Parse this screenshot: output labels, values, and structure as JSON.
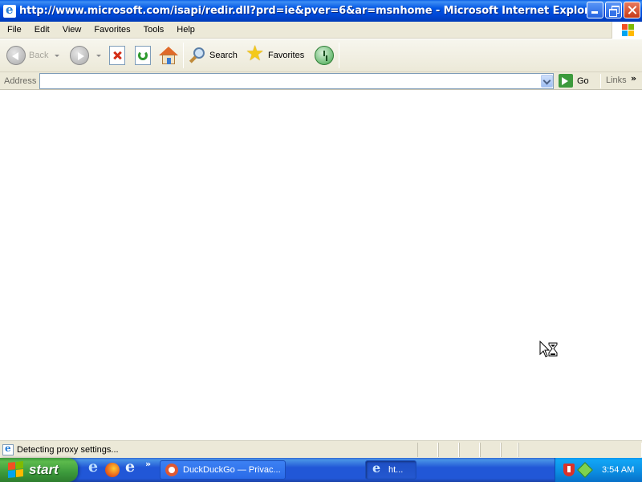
{
  "window": {
    "title": "http://www.microsoft.com/isapi/redir.dll?prd=ie&pver=6&ar=msnhome - Microsoft Internet Explorer"
  },
  "menubar": {
    "items": [
      "File",
      "Edit",
      "View",
      "Favorites",
      "Tools",
      "Help"
    ]
  },
  "toolbar": {
    "back_label": "Back",
    "search_label": "Search",
    "favorites_label": "Favorites",
    "icons": [
      "back-arrow",
      "forward-arrow",
      "stop",
      "refresh",
      "home",
      "search",
      "favorites-star",
      "history"
    ]
  },
  "address_bar": {
    "label": "Address",
    "value": "",
    "go_label": "Go",
    "links_label": "Links"
  },
  "status_bar": {
    "text": "Detecting proxy settings..."
  },
  "taskbar": {
    "start_label": "start",
    "quick_launch": [
      "internet-explorer-icon",
      "firefox-icon",
      "internet-explorer-icon"
    ],
    "tasks": [
      {
        "label": "DuckDuckGo — Privac...",
        "icon": "duckduckgo-icon",
        "active": false
      },
      {
        "label": "ht...",
        "icon": "internet-explorer-icon",
        "active": true
      }
    ],
    "clock": "3:54 AM"
  },
  "colors": {
    "titlebar": "#0054e3",
    "chrome": "#ece9d8",
    "taskbar": "#2157d7",
    "start": "#3c9a3c",
    "tray": "#0b8be0"
  }
}
